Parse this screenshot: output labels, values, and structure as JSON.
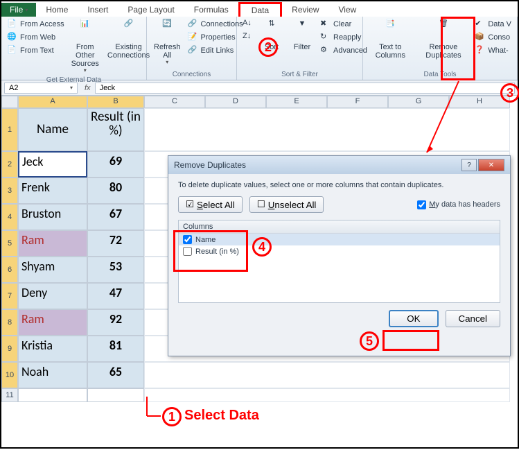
{
  "tabs": {
    "file": "File",
    "home": "Home",
    "insert": "Insert",
    "pagelayout": "Page Layout",
    "formulas": "Formulas",
    "data": "Data",
    "review": "Review",
    "view": "View"
  },
  "ribbon": {
    "getdata": {
      "access": "From Access",
      "web": "From Web",
      "text": "From Text",
      "other": "From Other Sources",
      "existing": "Existing Connections",
      "label": "Get External Data"
    },
    "connections": {
      "refresh": "Refresh All",
      "conn": "Connections",
      "props": "Properties",
      "edit": "Edit Links",
      "label": "Connections"
    },
    "sortfilter": {
      "sort": "Sort",
      "filter": "Filter",
      "clear": "Clear",
      "reapply": "Reapply",
      "advanced": "Advanced",
      "label": "Sort & Filter"
    },
    "datatools": {
      "texttocols": "Text to Columns",
      "removedup": "Remove Duplicates",
      "datav": "Data V",
      "conso": "Conso",
      "whatif": "What-",
      "label": "Data Tools"
    }
  },
  "formulaBar": {
    "nameBox": "A2",
    "fx": "fx",
    "value": "Jeck"
  },
  "colHeaders": [
    "A",
    "B",
    "C",
    "D",
    "E",
    "F",
    "G",
    "H"
  ],
  "table": {
    "header": {
      "name": "Name",
      "result": "Result (in %)"
    },
    "rows": [
      {
        "n": "2",
        "name": "Jeck",
        "result": "69",
        "active": true
      },
      {
        "n": "3",
        "name": "Frenk",
        "result": "80"
      },
      {
        "n": "4",
        "name": "Bruston",
        "result": "67"
      },
      {
        "n": "5",
        "name": "Ram",
        "result": "72",
        "ram": true
      },
      {
        "n": "6",
        "name": "Shyam",
        "result": "53"
      },
      {
        "n": "7",
        "name": "Deny",
        "result": "47"
      },
      {
        "n": "8",
        "name": "Ram",
        "result": "92",
        "ram": true
      },
      {
        "n": "9",
        "name": "Kristia",
        "result": "81"
      },
      {
        "n": "10",
        "name": "Noah",
        "result": "65"
      }
    ],
    "extraRow": "11"
  },
  "dialog": {
    "title": "Remove Duplicates",
    "desc": "To delete duplicate values, select one or more columns that contain duplicates.",
    "selectAll": "Select All",
    "unselectAll": "Unselect All",
    "headersCbx": "My data has headers",
    "colsHeader": "Columns",
    "col1": "Name",
    "col2": "Result (in %)",
    "ok": "OK",
    "cancel": "Cancel",
    "help": "?",
    "close": "✕"
  },
  "annotations": {
    "a1": "1",
    "a2": "2",
    "a3": "3",
    "a4": "4",
    "a5": "5",
    "selectData": "Select Data"
  }
}
